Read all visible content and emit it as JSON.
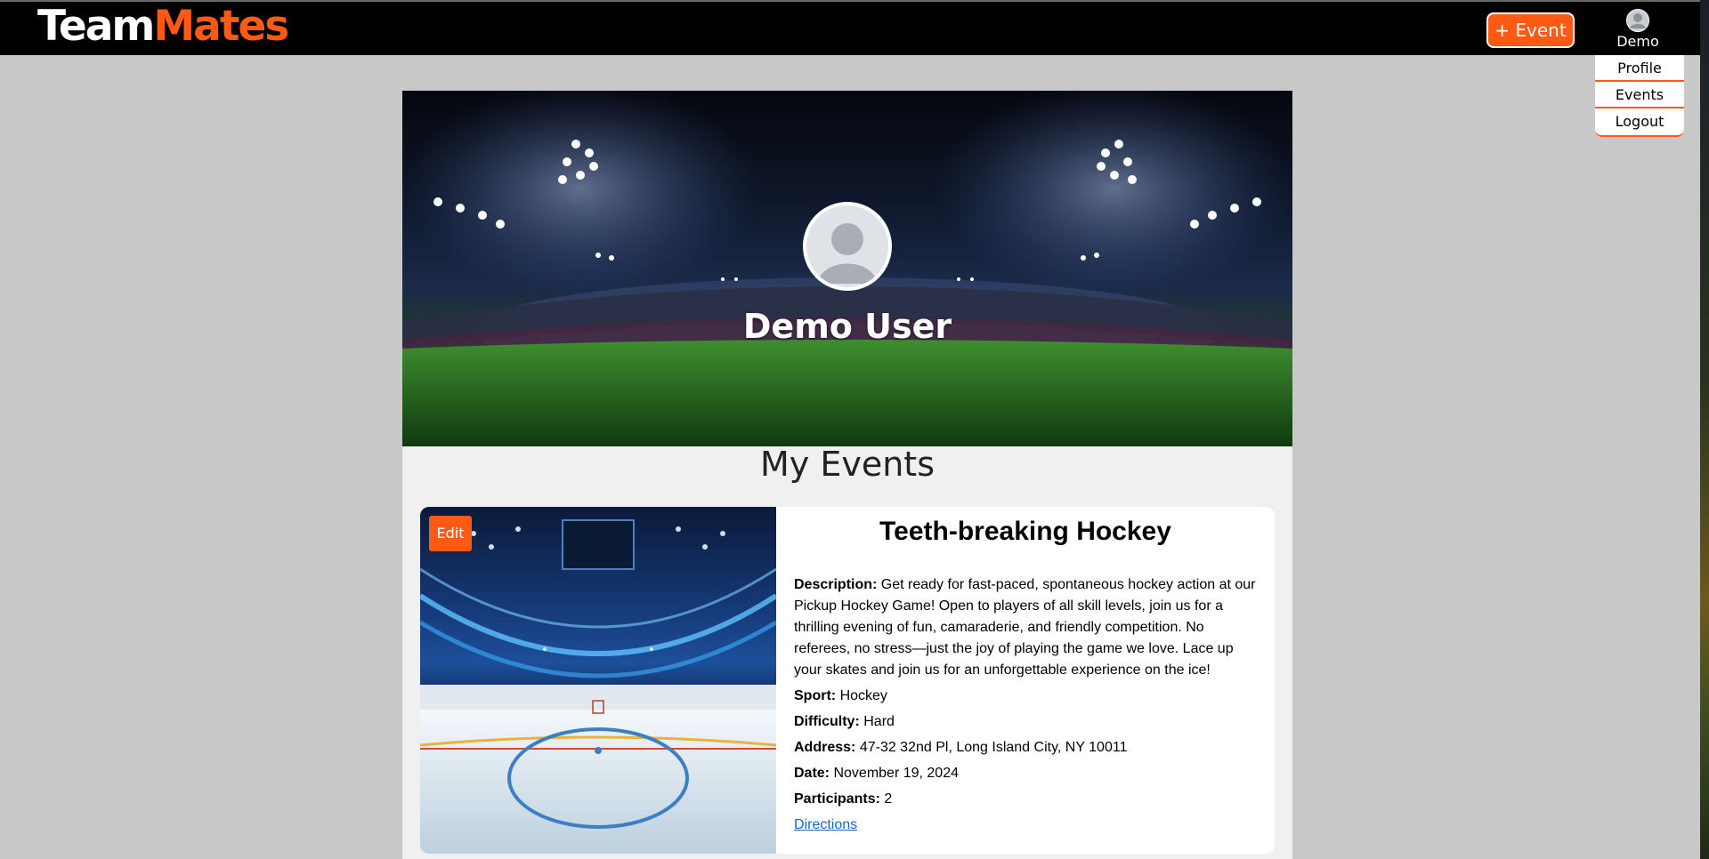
{
  "navbar": {
    "logo_part1": "Team",
    "logo_part2": "Mates",
    "add_event_label": "+ Event",
    "user_name": "Demo",
    "accent_color": "#ff5a14"
  },
  "dropdown": {
    "items": [
      {
        "label": "Profile"
      },
      {
        "label": "Events"
      },
      {
        "label": "Logout"
      }
    ]
  },
  "profile": {
    "name": "Demo User",
    "avatar_icon": "user-avatar-icon"
  },
  "events_section": {
    "title": "My Events"
  },
  "event": {
    "edit_label": "Edit",
    "title": "Teeth-breaking Hockey",
    "description_label": "Description:",
    "description": "Get ready for fast-paced, spontaneous hockey action at our Pickup Hockey Game! Open to players of all skill levels, join us for a thrilling evening of fun, camaraderie, and friendly competition. No referees, no stress—just the joy of playing the game we love. Lace up your skates and join us for an unforgettable experience on the ice!",
    "sport_label": "Sport:",
    "sport": "Hockey",
    "difficulty_label": "Difficulty:",
    "difficulty": "Hard",
    "address_label": "Address:",
    "address": "47-32 32nd Pl, Long Island City, NY 10011",
    "date_label": "Date:",
    "date": "November 19, 2024",
    "participants_label": "Participants:",
    "participants": "2",
    "directions_label": "Directions",
    "link_color": "#1a66d2"
  }
}
